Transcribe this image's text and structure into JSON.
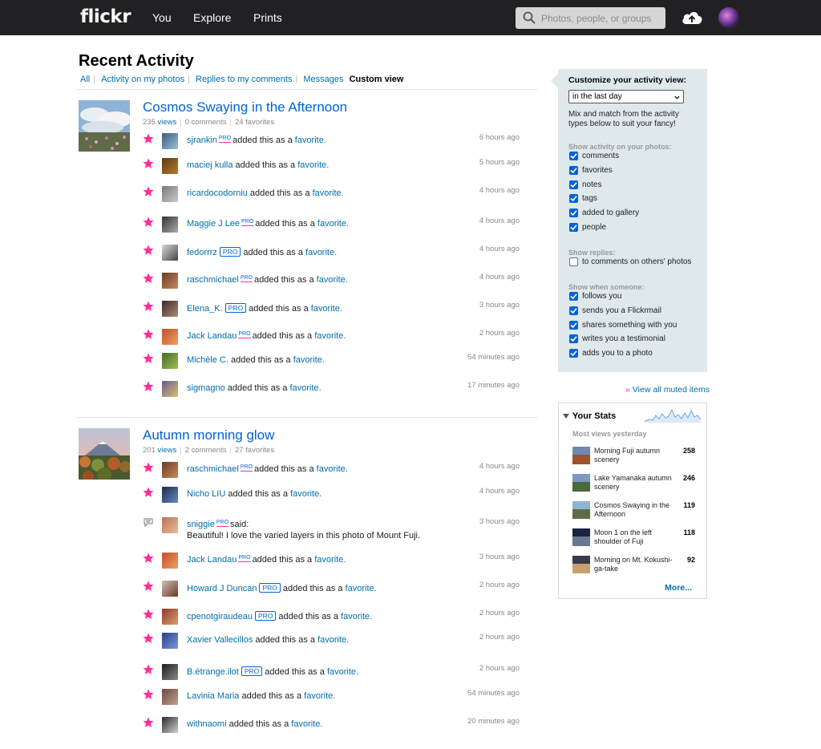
{
  "nav": {
    "logo": "flickr",
    "items": [
      "You",
      "Explore",
      "Prints"
    ],
    "search_placeholder": "Photos, people, or groups"
  },
  "page": {
    "title": "Recent Activity",
    "tabs": [
      {
        "label": "All"
      },
      {
        "label": "Activity on my photos"
      },
      {
        "label": "Replies to my comments"
      },
      {
        "label": "Messages"
      },
      {
        "label": "Custom view",
        "active": true
      }
    ]
  },
  "photos": [
    {
      "title": "Cosmos Swaying in the Afternoon",
      "views": "235",
      "views_label": "views",
      "comments": "0 comments",
      "favorites": "24 favorites",
      "activities": [
        {
          "user": "sjrankin",
          "pro": "underline",
          "action": "added this as a",
          "link": "favorite.",
          "time": "6 hours ago"
        },
        {
          "user": "maciej kulla",
          "pro": "",
          "action": "added this as a",
          "link": "favorite.",
          "time": "5 hours ago"
        },
        {
          "user": "ricardocodorniu",
          "pro": "",
          "action": "added this as a",
          "link": "favorite.",
          "time": "4 hours ago"
        },
        {
          "user": "Maggie J Lee",
          "pro": "underline",
          "action": "added this as a",
          "link": "favorite.",
          "time": "4 hours ago"
        },
        {
          "user": "fedorrrz",
          "pro": "box",
          "action": "added this as a",
          "link": "favorite.",
          "time": "4 hours ago"
        },
        {
          "user": "raschmichael",
          "pro": "underline",
          "action": "added this as a",
          "link": "favorite.",
          "time": "4 hours ago"
        },
        {
          "user": "Elena_K.",
          "pro": "box",
          "action": "added this as a",
          "link": "favorite.",
          "time": "3 hours ago"
        },
        {
          "user": "Jack Landau",
          "pro": "underline",
          "action": "added this as a",
          "link": "favorite.",
          "time": "2 hours ago"
        },
        {
          "user": "Michèle C.",
          "pro": "",
          "action": "added this as a",
          "link": "favorite.",
          "time": "54 minutes ago"
        },
        {
          "user": "sigmagno",
          "pro": "",
          "action": "added this as a",
          "link": "favorite.",
          "time": "17 minutes ago"
        }
      ]
    },
    {
      "title": "Autumn morning glow",
      "views": "201",
      "views_label": "views",
      "comments": "2 comments",
      "favorites": "27 favorites",
      "activities": [
        {
          "user": "raschmichael",
          "pro": "underline",
          "action": "added this as a",
          "link": "favorite.",
          "time": "4 hours ago"
        },
        {
          "user": "Nicho LIU",
          "pro": "",
          "action": "added this as a",
          "link": "favorite.",
          "time": "4 hours ago"
        },
        {
          "user": "sniggie",
          "pro": "underline",
          "action": "said:",
          "link": "",
          "comment": "Beautiful! I love the varied layers in this photo of Mount Fuji.",
          "time": "3 hours ago",
          "kind": "comment"
        },
        {
          "user": "Jack Landau",
          "pro": "underline",
          "action": "added this as a",
          "link": "favorite.",
          "time": "3 hours ago"
        },
        {
          "user": "Howard J Duncan",
          "pro": "box",
          "action": "added this as a",
          "link": "favorite.",
          "time": "2 hours ago"
        },
        {
          "user": "cpenotgiraudeau",
          "pro": "box",
          "action": "added this as a",
          "link": "favorite.",
          "time": "2 hours ago"
        },
        {
          "user": "Xavier Vallecillos",
          "pro": "",
          "action": "added this as a",
          "link": "favorite.",
          "time": "2 hours ago"
        },
        {
          "user": "B.étrange.ilot",
          "pro": "box",
          "action": "added this as a",
          "link": "favorite.",
          "time": "2 hours ago"
        },
        {
          "user": "Lavinia Maria",
          "pro": "",
          "action": "added this as a",
          "link": "favorite.",
          "time": "54 minutes ago"
        },
        {
          "user": "withnaomi",
          "pro": "",
          "action": "added this as a",
          "link": "favorite.",
          "time": "20 minutes ago"
        }
      ]
    }
  ],
  "pro_label": "PRO",
  "customize": {
    "title": "Customize your activity view:",
    "select_value": "in the last day",
    "description": "Mix and match from the activity types below to suit your fancy!",
    "sections": [
      {
        "heading": "Show activity on your photos:",
        "options": [
          {
            "label": "comments",
            "checked": true
          },
          {
            "label": "favorites",
            "checked": true
          },
          {
            "label": "notes",
            "checked": true
          },
          {
            "label": "tags",
            "checked": true
          },
          {
            "label": "added to gallery",
            "checked": true
          },
          {
            "label": "people",
            "checked": true
          }
        ]
      },
      {
        "heading": "Show replies:",
        "options": [
          {
            "label": "to comments on others' photos",
            "checked": false
          }
        ]
      },
      {
        "heading": "Show when someone:",
        "options": [
          {
            "label": "follows you",
            "checked": true
          },
          {
            "label": "sends you a Flickrmail",
            "checked": true
          },
          {
            "label": "shares something with you",
            "checked": true
          },
          {
            "label": "writes you a testimonial",
            "checked": true
          },
          {
            "label": "adds you to a photo",
            "checked": true
          }
        ]
      }
    ]
  },
  "muted": {
    "arrow": "»",
    "label": "View all muted items"
  },
  "stats": {
    "title": "Your Stats",
    "subtitle": "Most views yesterday",
    "items": [
      {
        "name": "Morning Fuji autumn scenery",
        "count": "258"
      },
      {
        "name": "Lake Yamanaka autumn scenery",
        "count": "246"
      },
      {
        "name": "Cosmos Swaying in the Afternoon",
        "count": "119"
      },
      {
        "name": "Moon 1 on the left shoulder of Fuji",
        "count": "118"
      },
      {
        "name": "Morning on Mt. Kokushi-ga-take",
        "count": "92"
      }
    ],
    "more": "More..."
  },
  "colors": {
    "topbar": "#212124",
    "link": "#006dac",
    "title_link": "#0063dc",
    "pro_pink": "#ff2e98",
    "star": "#ff2e98",
    "panel_bg": "#dfe9ec"
  },
  "icons": {
    "search": "search-icon",
    "upload": "cloud-upload-icon",
    "favorite": "star-icon",
    "comment": "comment-bubble-icon"
  }
}
